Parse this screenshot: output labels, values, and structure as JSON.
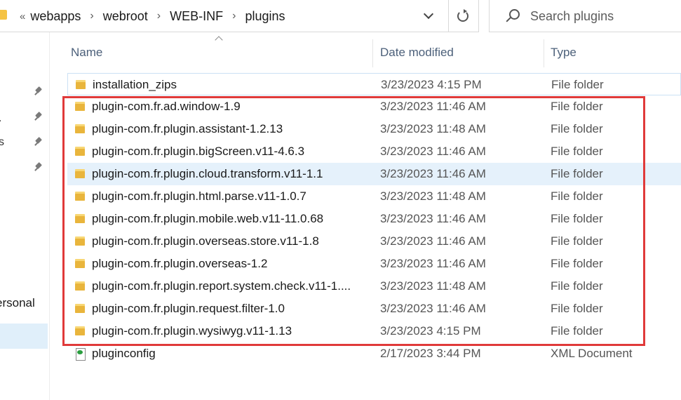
{
  "address_bar": {
    "overflow": "«",
    "crumbs": [
      "webapps",
      "webroot",
      "WEB-INF",
      "plugins"
    ],
    "separator": "›"
  },
  "search": {
    "placeholder": "Search plugins"
  },
  "nav": {
    "fragments": [
      ".",
      "s"
    ],
    "personal_label": "ersonal"
  },
  "columns": {
    "name": "Name",
    "date_modified": "Date modified",
    "type": "Type"
  },
  "files": [
    {
      "name": "installation_zips",
      "date": "3/23/2023 4:15 PM",
      "type": "File folder",
      "icon": "folder-icon"
    },
    {
      "name": "plugin-com.fr.ad.window-1.9",
      "date": "3/23/2023 11:46 AM",
      "type": "File folder",
      "icon": "folder-icon"
    },
    {
      "name": "plugin-com.fr.plugin.assistant-1.2.13",
      "date": "3/23/2023 11:48 AM",
      "type": "File folder",
      "icon": "folder-icon"
    },
    {
      "name": "plugin-com.fr.plugin.bigScreen.v11-4.6.3",
      "date": "3/23/2023 11:46 AM",
      "type": "File folder",
      "icon": "folder-icon"
    },
    {
      "name": "plugin-com.fr.plugin.cloud.transform.v11-1.1",
      "date": "3/23/2023 11:46 AM",
      "type": "File folder",
      "icon": "folder-icon"
    },
    {
      "name": "plugin-com.fr.plugin.html.parse.v11-1.0.7",
      "date": "3/23/2023 11:48 AM",
      "type": "File folder",
      "icon": "folder-icon"
    },
    {
      "name": "plugin-com.fr.plugin.mobile.web.v11-11.0.68",
      "date": "3/23/2023 11:46 AM",
      "type": "File folder",
      "icon": "folder-icon"
    },
    {
      "name": "plugin-com.fr.plugin.overseas.store.v11-1.8",
      "date": "3/23/2023 11:46 AM",
      "type": "File folder",
      "icon": "folder-icon"
    },
    {
      "name": "plugin-com.fr.plugin.overseas-1.2",
      "date": "3/23/2023 11:46 AM",
      "type": "File folder",
      "icon": "folder-icon"
    },
    {
      "name": "plugin-com.fr.plugin.report.system.check.v11-1....",
      "date": "3/23/2023 11:48 AM",
      "type": "File folder",
      "icon": "folder-icon"
    },
    {
      "name": "plugin-com.fr.plugin.request.filter-1.0",
      "date": "3/23/2023 11:46 AM",
      "type": "File folder",
      "icon": "folder-icon"
    },
    {
      "name": "plugin-com.fr.plugin.wysiwyg.v11-1.13",
      "date": "3/23/2023 4:15 PM",
      "type": "File folder",
      "icon": "folder-icon"
    },
    {
      "name": "pluginconfig",
      "date": "2/17/2023 3:44 PM",
      "type": "XML Document",
      "icon": "xml-file-icon"
    }
  ],
  "colors": {
    "highlight_border": "#e03a3a",
    "hover_row": "#e5f1fb",
    "folder": "#f8d775",
    "column_header_text": "#4c607a"
  }
}
